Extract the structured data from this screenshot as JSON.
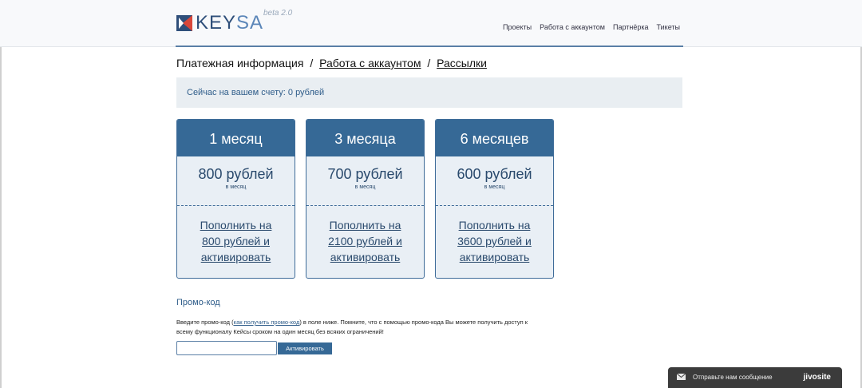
{
  "header": {
    "logo_key": "KEY",
    "logo_sa": "SA",
    "beta": "beta 2.0",
    "nav": [
      "Проекты",
      "Работа с аккаунтом",
      "Партнёрка",
      "Тикеты"
    ]
  },
  "breadcrumb": {
    "first": "Платежная информация",
    "sep": "/",
    "second": "Работа с аккаунтом",
    "third": "Рассылки"
  },
  "balance": {
    "text": "Сейчас на вашем счету: 0 рублей"
  },
  "plans": [
    {
      "title": "1 месяц",
      "price": "800 рублей",
      "per": "в месяц",
      "action_lines": [
        "Пополнить на",
        "800 рублей и",
        "активировать"
      ]
    },
    {
      "title": "3 месяца",
      "price": "700 рублей",
      "per": "в месяц",
      "action_lines": [
        "Пополнить на",
        "2100 рублей и",
        "активировать"
      ]
    },
    {
      "title": "6 месяцев",
      "price": "600 рублей",
      "per": "в месяц",
      "action_lines": [
        "Пополнить на",
        "3600 рублей и",
        "активировать"
      ]
    }
  ],
  "promo": {
    "title": "Промо-код",
    "text_before": "Введите промо-код (",
    "link": "как получить промо-код",
    "text_after": ") в поле ниже. Помните, что с помощью промо-кода Вы можете получить доступ к всему функционалу Кейсы сроком на один месяц без всяких ограничений!",
    "input_value": "",
    "button": "Активировать"
  },
  "chat": {
    "text": "Отправьте нам сообщение",
    "brand": "jivosite"
  },
  "colors": {
    "primary": "#366996",
    "light": "#e9eff5",
    "accent_text": "#2f5d8a"
  }
}
